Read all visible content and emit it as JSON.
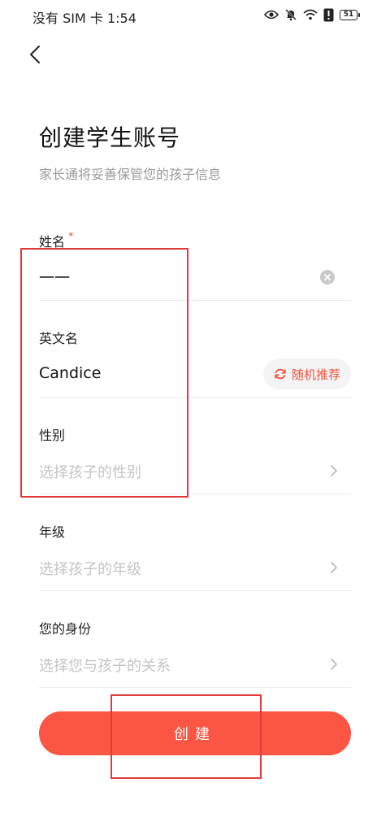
{
  "status_bar": {
    "carrier_time": "没有 SIM 卡 1:54",
    "battery": "51"
  },
  "header": {
    "title": "创建学生账号",
    "subtitle": "家长通将妥善保管您的孩子信息"
  },
  "form": {
    "name": {
      "label": "姓名",
      "required_mark": "*",
      "value": "一一"
    },
    "english_name": {
      "label": "英文名",
      "value": "Candice",
      "random_button": "随机推荐"
    },
    "gender": {
      "label": "性别",
      "placeholder": "选择孩子的性别"
    },
    "grade": {
      "label": "年级",
      "placeholder": "选择孩子的年级"
    },
    "identity": {
      "label": "您的身份",
      "placeholder": "选择您与孩子的关系"
    }
  },
  "submit": {
    "label": "创建"
  },
  "colors": {
    "accent": "#fb5543",
    "placeholder": "#c4c4c4",
    "annotation": "#e23a3a"
  }
}
